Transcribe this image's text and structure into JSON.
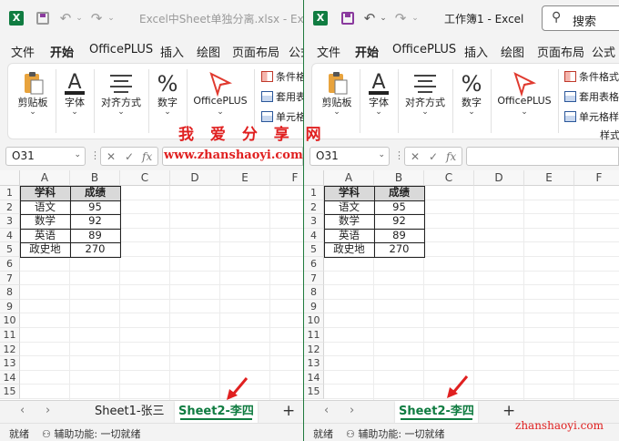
{
  "left_window": {
    "title": "Excel中Sheet单独分离.xlsx - Ex...",
    "tabs": [
      "文件",
      "开始",
      "OfficePLUS",
      "插入",
      "绘图",
      "页面布局",
      "公式"
    ],
    "name_box": "O31",
    "sheet_tabs": [
      "Sheet1-张三",
      "Sheet2-李四"
    ],
    "active_sheet": "Sheet2-李四"
  },
  "right_window": {
    "title": "工作簿1 - Excel",
    "search_label": "搜索",
    "tabs": [
      "文件",
      "开始",
      "OfficePLUS",
      "插入",
      "绘图",
      "页面布局",
      "公式"
    ],
    "name_box": "O31",
    "ribbon_group_label": "样式",
    "sheet_tabs": [
      "Sheet2-李四"
    ],
    "active_sheet": "Sheet2-李四"
  },
  "ribbon": {
    "clipboard": "剪贴板",
    "font": "字体",
    "alignment": "对齐方式",
    "number": "数字",
    "officeplus": "OfficePLUS",
    "cond_format": "条件格式",
    "table_format": "套用表格",
    "cell_styles": "单元格样",
    "cond_format_right": "条件格式",
    "table_format_right": "套用表格格",
    "cell_styles_right": "单元格样式"
  },
  "formula": {
    "fx": "fx"
  },
  "columns": [
    "A",
    "B",
    "C",
    "D",
    "E",
    "F"
  ],
  "rows": [
    "1",
    "2",
    "3",
    "4",
    "5",
    "6",
    "7",
    "8",
    "9",
    "10",
    "11",
    "12",
    "13",
    "14",
    "15"
  ],
  "table": {
    "headers": [
      "学科",
      "成绩"
    ],
    "rows": [
      [
        "语文",
        "95"
      ],
      [
        "数学",
        "92"
      ],
      [
        "英语",
        "89"
      ],
      [
        "政史地",
        "270"
      ]
    ]
  },
  "status": {
    "ready": "就绪",
    "accessibility": "辅助功能: 一切就绪"
  },
  "watermark": {
    "cn": "我 爱 分 享 网",
    "url": "www.zhanshaoyi.com",
    "url_small": "zhanshaoyi.com"
  },
  "colors": {
    "excel_green": "#107c41",
    "annotation_red": "#e02020"
  }
}
